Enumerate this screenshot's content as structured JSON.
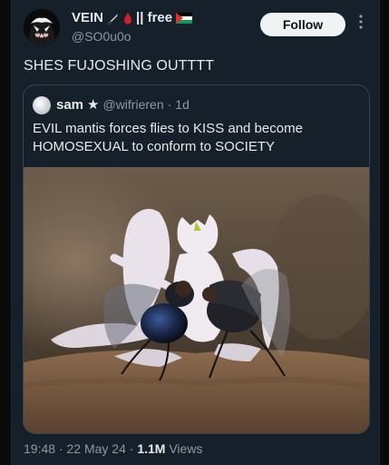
{
  "tweet": {
    "display_name": "VEIN",
    "name_suffix": "|| free",
    "handle": "@SO0u0o",
    "follow_label": "Follow",
    "text": "SHES FUJOSHING OUTTTT"
  },
  "quote": {
    "display_name": "sam",
    "star": "★",
    "handle": "@wifrieren",
    "separator": "·",
    "age": "1d",
    "text": "EVIL mantis forces flies to KISS and become HOMOSEXUAL to conform to SOCIETY"
  },
  "footer": {
    "time": "19:48",
    "dot1": "·",
    "date": "22 May 24",
    "dot2": "·",
    "views_count": "1.1M",
    "views_label": "Views"
  },
  "colors": {
    "background": "#15202b",
    "text": "#e7e9ea",
    "muted": "#8b98a5",
    "follow_bg": "#eff3f4"
  },
  "icons": [
    "venom-avatar",
    "knife-icon",
    "blood-drop-icon",
    "palestine-flag-icon",
    "more-icon",
    "globe-avatar"
  ]
}
